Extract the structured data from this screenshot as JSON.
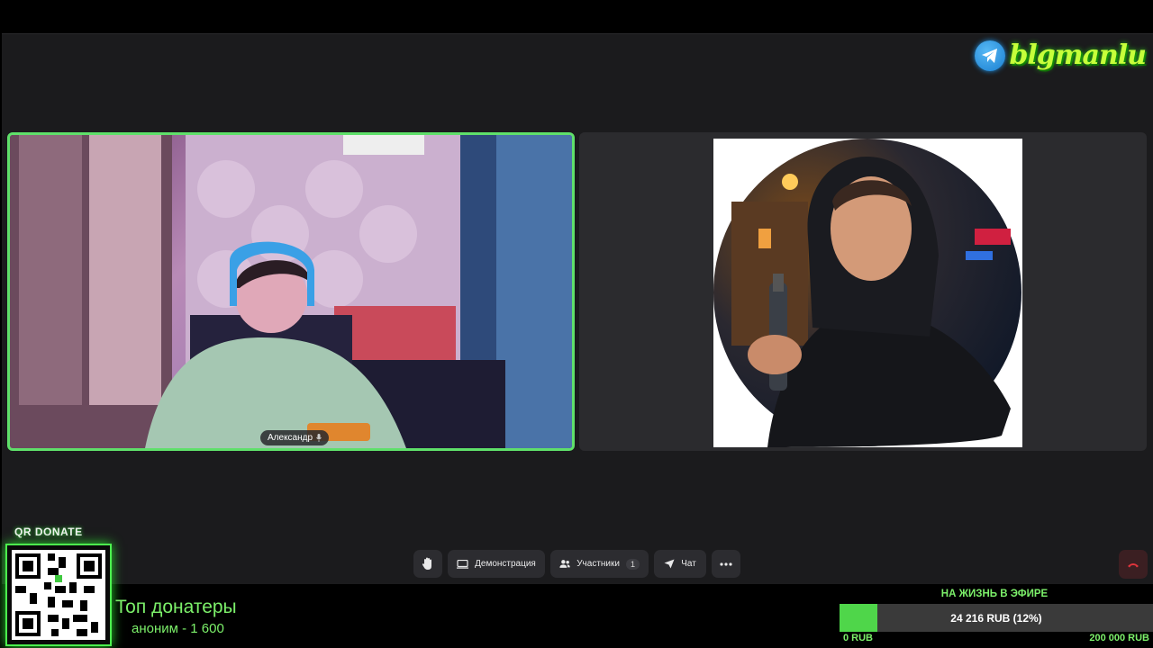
{
  "brand": {
    "name": "blgmanlu"
  },
  "participants": [
    {
      "name": "Александр",
      "has_video": true
    },
    {
      "name": "",
      "has_video": false
    }
  ],
  "toolbar": {
    "screen_share_label": "Демонстрация",
    "participants_label": "Участники",
    "participants_count": "1",
    "chat_label": "Чат"
  },
  "overlay": {
    "qr_title": "QR DONATE",
    "top_donors_title": "Топ донатеры",
    "top_donors": [
      {
        "text": "аноним - 1 600"
      }
    ],
    "goal": {
      "title": "НА ЖИЗНЬ В ЭФИРЕ",
      "progress_text": "24 216 RUB (12%)",
      "progress_fraction": 0.12,
      "min_label": "0 RUB",
      "max_label": "200 000 RUB"
    }
  },
  "colors": {
    "accent_green": "#5fe06a",
    "call_bg": "#1b1b1d",
    "hangup_red": "#e0343c"
  }
}
